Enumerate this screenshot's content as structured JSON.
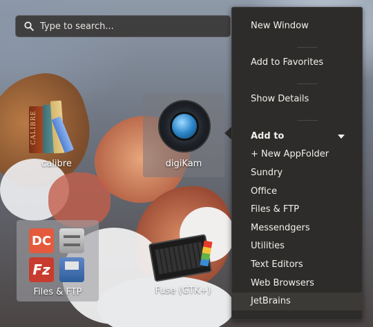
{
  "search": {
    "placeholder": "Type to search..."
  },
  "apps": [
    {
      "label": "calibre",
      "icon_text": "CALIBRE"
    },
    {
      "label": "digiKam"
    },
    {
      "label": "Files & FTP"
    },
    {
      "label": "Fuse (GTK+)"
    }
  ],
  "context_menu": {
    "items": [
      {
        "label": "New Window"
      },
      {
        "label": "Add to Favorites"
      },
      {
        "label": "Show Details"
      }
    ],
    "add_to": {
      "header": "Add to",
      "items": [
        {
          "label": "+ New AppFolder"
        },
        {
          "label": "Sundry"
        },
        {
          "label": "Office"
        },
        {
          "label": "Files & FTP"
        },
        {
          "label": "Messendgers"
        },
        {
          "label": "Utilities"
        },
        {
          "label": "Text Editors"
        },
        {
          "label": "Web Browsers"
        },
        {
          "label": "JetBrains"
        }
      ]
    }
  },
  "colors": {
    "menu_bg": "#2d2c2a",
    "menu_text": "#f3f0ec",
    "highlight": "#3b3a37"
  }
}
